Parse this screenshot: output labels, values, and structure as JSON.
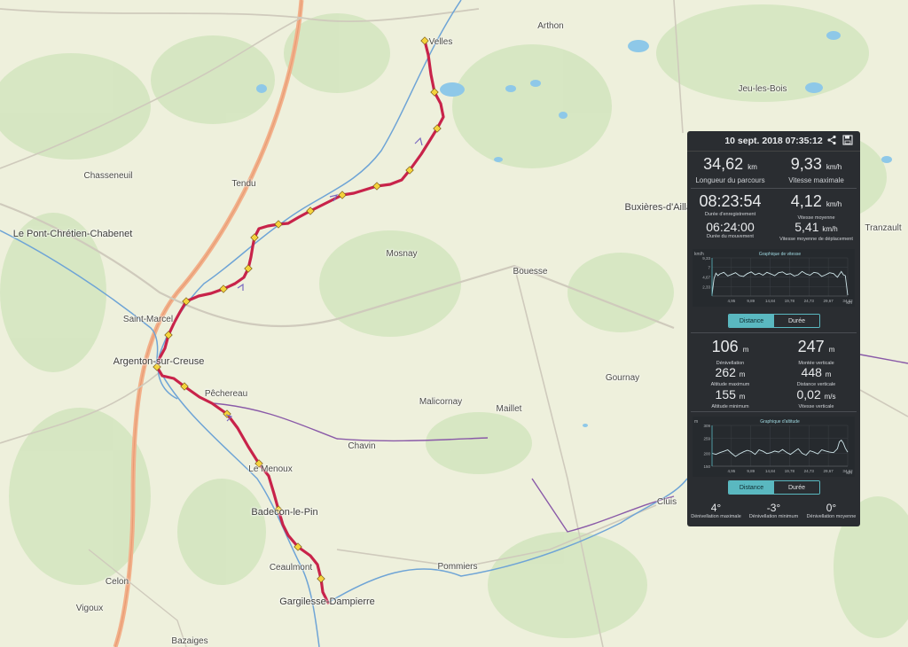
{
  "map": {
    "places": [
      {
        "name": "Velles",
        "x": 497,
        "y": 48
      },
      {
        "name": "Arthon",
        "x": 621,
        "y": 30
      },
      {
        "name": "Jeu-les-Bois",
        "x": 860,
        "y": 101
      },
      {
        "name": "Chasseneuil",
        "x": 122,
        "y": 199
      },
      {
        "name": "Tendu",
        "x": 275,
        "y": 208
      },
      {
        "name": "Buxières-d'Aillac",
        "x": 745,
        "y": 234
      },
      {
        "name": "Tranzault",
        "x": 996,
        "y": 258
      },
      {
        "name": "Le Pont-Chrétien-Chabenet",
        "x": 82,
        "y": 264
      },
      {
        "name": "Mosnay",
        "x": 453,
        "y": 287
      },
      {
        "name": "Bouesse",
        "x": 598,
        "y": 307
      },
      {
        "name": "Saint-Marcel",
        "x": 167,
        "y": 361
      },
      {
        "name": "Argenton-sur-Creuse",
        "x": 179,
        "y": 408
      },
      {
        "name": "Gournay",
        "x": 702,
        "y": 427
      },
      {
        "name": "Pêchereau",
        "x": 255,
        "y": 445
      },
      {
        "name": "Malicornay",
        "x": 497,
        "y": 454
      },
      {
        "name": "Maillet",
        "x": 574,
        "y": 462
      },
      {
        "name": "Chavin",
        "x": 408,
        "y": 504
      },
      {
        "name": "Le Menoux",
        "x": 305,
        "y": 530
      },
      {
        "name": "Badecon-le-Pin",
        "x": 321,
        "y": 578
      },
      {
        "name": "Cluis",
        "x": 752,
        "y": 567
      },
      {
        "name": "Ceaulmont",
        "x": 328,
        "y": 641
      },
      {
        "name": "Pommiers",
        "x": 516,
        "y": 640
      },
      {
        "name": "Celon",
        "x": 132,
        "y": 657
      },
      {
        "name": "Gargilesse-Dampierre",
        "x": 369,
        "y": 679
      },
      {
        "name": "Vigoux",
        "x": 101,
        "y": 687
      },
      {
        "name": "Bazaiges",
        "x": 214,
        "y": 724
      }
    ],
    "route_color": "#c8234a",
    "track": [
      [
        479,
        46
      ],
      [
        483,
        62
      ],
      [
        486,
        84
      ],
      [
        490,
        104
      ],
      [
        497,
        117
      ],
      [
        500,
        132
      ],
      [
        493,
        145
      ],
      [
        485,
        158
      ],
      [
        475,
        174
      ],
      [
        462,
        192
      ],
      [
        453,
        203
      ],
      [
        440,
        208
      ],
      [
        425,
        210
      ],
      [
        412,
        214
      ],
      [
        399,
        218
      ],
      [
        386,
        220
      ],
      [
        374,
        226
      ],
      [
        362,
        232
      ],
      [
        350,
        238
      ],
      [
        337,
        245
      ],
      [
        325,
        252
      ],
      [
        314,
        253
      ],
      [
        302,
        255
      ],
      [
        292,
        258
      ],
      [
        287,
        268
      ],
      [
        285,
        278
      ],
      [
        283,
        290
      ],
      [
        280,
        303
      ],
      [
        275,
        313
      ],
      [
        265,
        320
      ],
      [
        252,
        326
      ],
      [
        238,
        331
      ],
      [
        224,
        334
      ],
      [
        210,
        340
      ],
      [
        203,
        352
      ],
      [
        197,
        363
      ],
      [
        190,
        378
      ],
      [
        186,
        393
      ],
      [
        180,
        404
      ],
      [
        177,
        414
      ],
      [
        183,
        424
      ],
      [
        196,
        427
      ],
      [
        208,
        436
      ],
      [
        225,
        448
      ],
      [
        239,
        455
      ],
      [
        256,
        467
      ],
      [
        268,
        483
      ],
      [
        280,
        504
      ],
      [
        292,
        523
      ],
      [
        303,
        537
      ],
      [
        309,
        557
      ],
      [
        314,
        575
      ],
      [
        319,
        592
      ],
      [
        325,
        604
      ],
      [
        336,
        617
      ],
      [
        350,
        627
      ],
      [
        358,
        637
      ],
      [
        362,
        653
      ],
      [
        364,
        668
      ],
      [
        370,
        680
      ]
    ]
  },
  "panel": {
    "datetime": "10 sept. 2018 07:35:12",
    "share_icon": "share-icon",
    "save_icon": "floppy-disk-icon",
    "length": {
      "value": "34,62",
      "unit": "km",
      "label": "Longueur du parcours"
    },
    "max_speed": {
      "value": "9,33",
      "unit": "km/h",
      "label": "Vitesse maximale"
    },
    "rec_duration": {
      "value": "08:23:54",
      "label": "Durée d'enregistrement"
    },
    "avg_speed": {
      "value": "4,12",
      "unit": "km/h",
      "label": "Vitesse moyenne"
    },
    "moving_duration": {
      "value": "06:24:00",
      "label": "Durée du mouvement"
    },
    "avg_moving_speed": {
      "value": "5,41",
      "unit": "km/h",
      "label": "Vitesse moyenne de déplacement"
    },
    "speed_chart_title": "Graphique de vitesse",
    "toggle1": {
      "distance": "Distance",
      "duration": "Durée"
    },
    "elev_diff": {
      "value": "106",
      "unit": "m",
      "label": "Dénivellation"
    },
    "climb": {
      "value": "247",
      "unit": "m",
      "label": "Montée verticale"
    },
    "alt_max": {
      "value": "262",
      "unit": "m",
      "label": "Altitude maximum"
    },
    "vert_dist": {
      "value": "448",
      "unit": "m",
      "label": "Distance verticale"
    },
    "alt_min": {
      "value": "155",
      "unit": "m",
      "label": "Altitude minimum"
    },
    "vert_speed": {
      "value": "0,02",
      "unit": "m/s",
      "label": "Vitesse verticale"
    },
    "elev_chart_title": "Graphique d'altitude",
    "toggle2": {
      "distance": "Distance",
      "duration": "Durée"
    },
    "slope_max": {
      "value": "4°",
      "label": "Dénivellation maximale"
    },
    "slope_min": {
      "value": "-3°",
      "label": "Dénivellation minimum"
    },
    "slope_avg": {
      "value": "0°",
      "label": "Dénivellation moyenne"
    }
  },
  "chart_data": [
    {
      "type": "line",
      "title": "Graphique de vitesse",
      "ylabel": "km/h",
      "xlabel": "km",
      "x_ticks": [
        "4,95",
        "9,89",
        "14,84",
        "19,78",
        "24,73",
        "29,67",
        "34,62"
      ],
      "y_ticks": [
        "2,33",
        "4,67",
        "7",
        "9,33"
      ],
      "xlim": [
        0,
        34.62
      ],
      "ylim": [
        0,
        9.33
      ],
      "series": [
        {
          "x": [
            0,
            0.5,
            1,
            1.5,
            2,
            3,
            4,
            5,
            6,
            7,
            8,
            9,
            10,
            11,
            12,
            13,
            14,
            15,
            16,
            17,
            18,
            19,
            20,
            21,
            22,
            23,
            24,
            25,
            26,
            27,
            28,
            29,
            30,
            31,
            32,
            33,
            33.5,
            34,
            34.62
          ],
          "values": [
            0.3,
            4.2,
            5.6,
            5.0,
            5.4,
            5.8,
            4.9,
            5.3,
            5.7,
            5.0,
            4.8,
            5.5,
            5.9,
            5.2,
            5.6,
            5.1,
            5.8,
            5.4,
            5.0,
            5.7,
            5.9,
            5.3,
            5.5,
            4.9,
            5.2,
            6.0,
            5.4,
            5.1,
            5.8,
            5.6,
            4.8,
            5.2,
            5.7,
            5.5,
            4.6,
            6.0,
            5.2,
            5.0,
            0.2
          ]
        }
      ]
    },
    {
      "type": "line",
      "title": "Graphique d'altitude",
      "ylabel": "m",
      "xlabel": "km",
      "x_ticks": [
        "4,95",
        "9,89",
        "14,84",
        "19,78",
        "24,73",
        "29,67",
        "34,62"
      ],
      "y_ticks": [
        "150",
        "200",
        "259",
        "309"
      ],
      "xlim": [
        0,
        34.62
      ],
      "ylim": [
        150,
        309
      ],
      "series": [
        {
          "x": [
            0,
            1,
            2,
            3,
            4,
            5,
            6,
            7,
            8,
            9,
            10,
            11,
            12,
            13,
            14,
            15,
            16,
            17,
            18,
            19,
            20,
            21,
            22,
            23,
            24,
            25,
            26,
            27,
            28,
            29,
            30,
            31,
            32,
            32.5,
            33,
            33.5,
            34,
            34.62
          ],
          "values": [
            200,
            196,
            203,
            208,
            214,
            200,
            188,
            198,
            206,
            212,
            207,
            196,
            214,
            208,
            199,
            203,
            209,
            205,
            215,
            204,
            196,
            207,
            218,
            200,
            193,
            210,
            205,
            198,
            214,
            209,
            205,
            203,
            218,
            245,
            252,
            240,
            220,
            205
          ]
        }
      ]
    }
  ]
}
